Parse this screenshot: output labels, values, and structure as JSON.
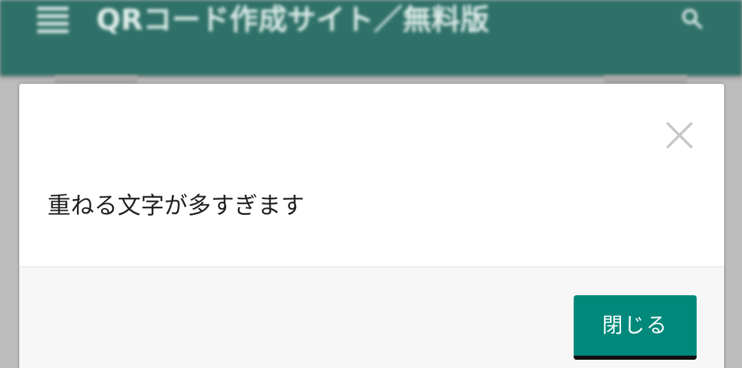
{
  "appbar": {
    "title": "QRコード作成サイト／無料版",
    "color": "#2f7168"
  },
  "icons": {
    "menu": "hamburger-menu-icon",
    "search": "search-icon",
    "close": "close-icon"
  },
  "dialog": {
    "message": "重ねる文字が多すぎます",
    "close_label": "閉じる",
    "button_color": "#00897b"
  }
}
